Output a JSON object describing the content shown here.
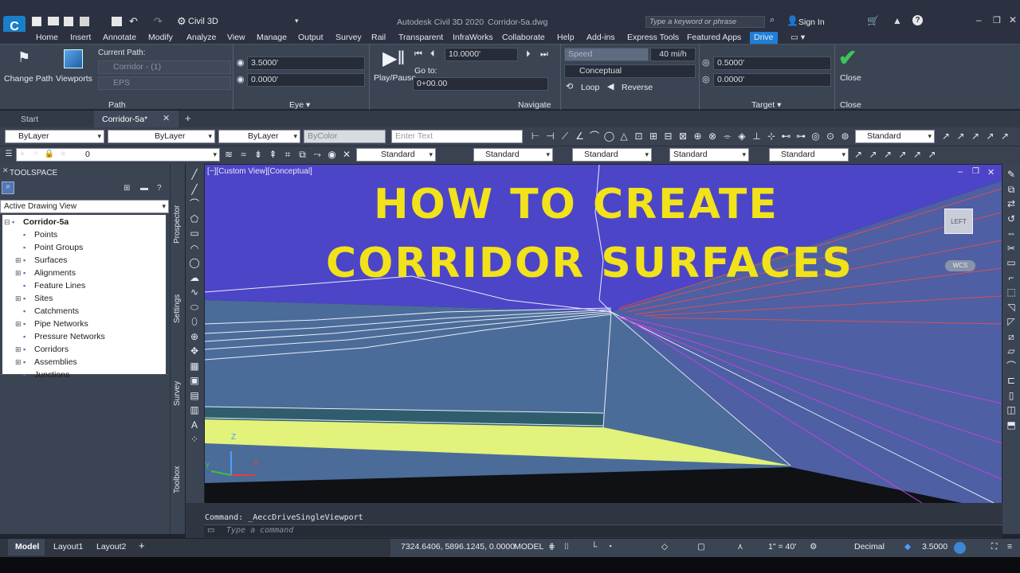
{
  "app": {
    "title": "Autodesk Civil 3D 2020",
    "file": "Corridor-5a.dwg",
    "workspace": "Civil 3D",
    "search_placeholder": "Type a keyword or phrase",
    "sign_in": "Sign In"
  },
  "menu": [
    "Home",
    "Insert",
    "Annotate",
    "Modify",
    "Analyze",
    "View",
    "Manage",
    "Output",
    "Survey",
    "Rail",
    "Transparent",
    "InfraWorks",
    "Collaborate",
    "Help",
    "Add-ins",
    "Express Tools",
    "Featured Apps",
    "Drive"
  ],
  "ribbon": {
    "change_path": "Change Path",
    "viewports": "Viewports",
    "current_path_label": "Current Path:",
    "current_path_value": "Corridor - (1)",
    "eps": "EPS",
    "path_title": "Path",
    "eye_height": "3.5000'",
    "eye_offset": "0.0000'",
    "eye_title": "Eye",
    "play_pause": "Play/Pause",
    "step": "10.0000'",
    "goto_label": "Go to:",
    "goto_value": "0+00.00",
    "navigate_title": "Navigate",
    "speed_label": "Speed",
    "speed_value": "40 mi/h",
    "visual_style": "Conceptual",
    "loop": "Loop",
    "reverse": "Reverse",
    "target_height": "0.5000'",
    "target_offset": "0.0000'",
    "target_title": "Target",
    "close": "Close",
    "close_title": "Close"
  },
  "doctabs": {
    "start": "Start",
    "active": "Corridor-5a*"
  },
  "props": {
    "layer": "ByLayer",
    "linetype": "ByLayer",
    "lineweight": "ByLayer",
    "color": "ByColor",
    "text_placeholder": "Enter Text",
    "style1": "Standard",
    "layer_value": "0",
    "style2": "Standard",
    "style3": "Standard",
    "style4": "Standard",
    "style5": "Standard",
    "style6": "Standard"
  },
  "toolspace": {
    "title": "TOOLSPACE",
    "view_select": "Active Drawing View",
    "tabs": [
      "Prospector",
      "Settings",
      "Survey",
      "Toolbox"
    ],
    "tree": [
      "Corridor-5a",
      "Points",
      "Point Groups",
      "Surfaces",
      "Alignments",
      "Feature Lines",
      "Sites",
      "Catchments",
      "Pipe Networks",
      "Pressure Networks",
      "Corridors",
      "Assemblies",
      "Junctions"
    ]
  },
  "viewport": {
    "label": "[−][Custom View][Conceptual]",
    "overlay_line1": "HOW TO CREATE",
    "overlay_line2": "CORRIDOR SURFACES",
    "viewcube_face": "LEFT",
    "wcs": "WCS",
    "axis_z": "Z",
    "axis_y": "Y",
    "axis_x": "X"
  },
  "command": {
    "history": "Command: _AeccDriveSingleViewport",
    "placeholder": "Type a command"
  },
  "status": {
    "tabs": [
      "Model",
      "Layout1",
      "Layout2"
    ],
    "coords": "7324.6406, 5896.1245, 0.0000",
    "space": "MODEL",
    "scale": "1\" = 40'",
    "units": "Decimal",
    "elevation": "3.5000"
  },
  "colors": {
    "overlay_text": "#f2e21a",
    "sky": "#4c45c8",
    "ground": "#e2f27a",
    "accent_drive": "#1f7fd8"
  }
}
